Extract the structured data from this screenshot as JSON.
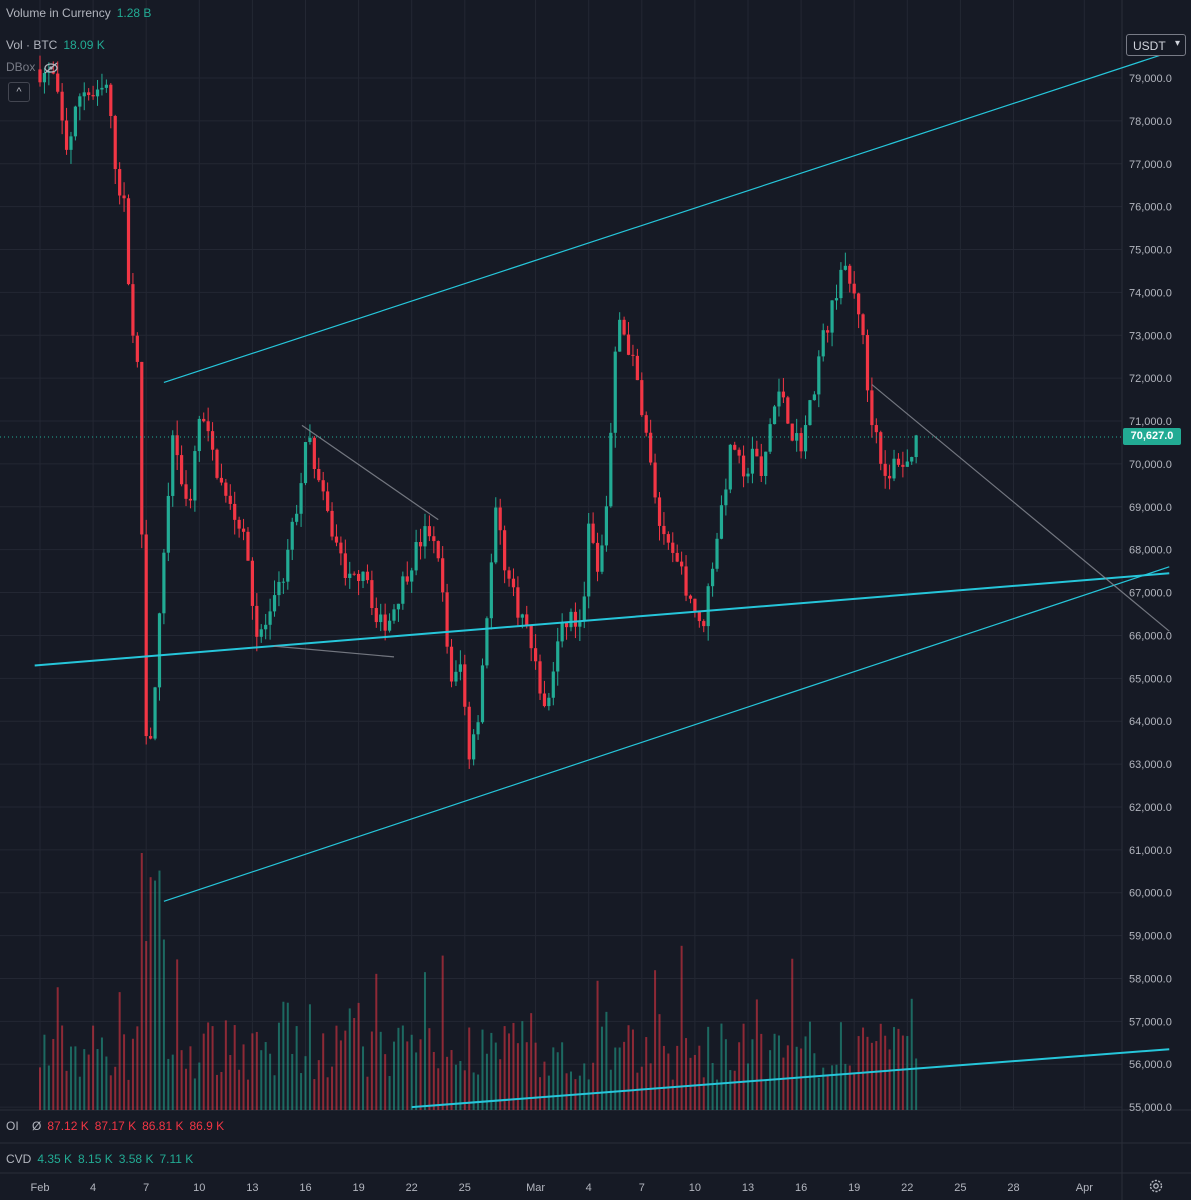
{
  "header": {
    "volume_in_currency_label": "Volume in Currency",
    "volume_in_currency_value": "1.28 B",
    "vol_label": "Vol · BTC",
    "vol_value": "18.09 K",
    "dbox_label": "DBox",
    "collapse_symbol": "^"
  },
  "currency_selector": {
    "value": "USDT"
  },
  "last_price_label": "70,627.0",
  "oi_row": {
    "label": "OI",
    "symbol": "Ø",
    "v1": "87.12 K",
    "v2": "87.17 K",
    "v3": "86.81 K",
    "v4": "86.9 K"
  },
  "cvd_row": {
    "label": "CVD",
    "v1": "4.35 K",
    "v2": "8.15 K",
    "v3": "3.58 K",
    "v4": "7.11 K"
  },
  "colors": {
    "up": "#22ab94",
    "down": "#f23645",
    "trend": "#26c6da",
    "grid": "#232733",
    "bg": "#161a25"
  },
  "chart_data": {
    "type": "candlestick",
    "y_axis": {
      "min": 54700,
      "max": 80300,
      "step": 1000,
      "tick_labels": [
        "79,000.0",
        "78,000.0",
        "77,000.0",
        "76,000.0",
        "75,000.0",
        "74,000.0",
        "73,000.0",
        "72,000.0",
        "71,000.0",
        "70,000.0",
        "69,000.0",
        "68,000.0",
        "67,000.0",
        "66,000.0",
        "65,000.0",
        "64,000.0",
        "63,000.0",
        "62,000.0",
        "61,000.0",
        "60,000.0",
        "59,000.0",
        "58,000.0",
        "57,000.0",
        "56,000.0",
        "55,000.0"
      ]
    },
    "x_axis": {
      "tick_labels": [
        "Feb",
        "4",
        "7",
        "10",
        "13",
        "16",
        "19",
        "22",
        "25",
        "Mar",
        "4",
        "7",
        "10",
        "13",
        "16",
        "19",
        "22",
        "25",
        "28",
        "Apr"
      ],
      "tick_days": [
        1,
        4,
        7,
        10,
        13,
        16,
        19,
        22,
        25,
        29,
        32,
        35,
        38,
        41,
        44,
        47,
        50,
        53,
        56,
        60
      ]
    },
    "last_price": 70627,
    "price_path": [
      [
        0.0,
        79200
      ],
      [
        1.0,
        79000
      ],
      [
        1.8,
        77300
      ],
      [
        2.6,
        78800
      ],
      [
        3.4,
        78500
      ],
      [
        4.0,
        78800
      ],
      [
        4.6,
        76700
      ],
      [
        5.0,
        76000
      ],
      [
        5.4,
        73500
      ],
      [
        5.8,
        72000
      ],
      [
        6.3,
        62900
      ],
      [
        6.8,
        65000
      ],
      [
        7.3,
        68300
      ],
      [
        7.8,
        70800
      ],
      [
        8.6,
        68800
      ],
      [
        9.3,
        71200
      ],
      [
        10.0,
        70200
      ],
      [
        10.8,
        69100
      ],
      [
        11.8,
        68500
      ],
      [
        12.5,
        66000
      ],
      [
        13.2,
        66300
      ],
      [
        14.0,
        67400
      ],
      [
        14.8,
        69100
      ],
      [
        15.4,
        70700
      ],
      [
        16.2,
        69200
      ],
      [
        17.0,
        68100
      ],
      [
        17.8,
        67200
      ],
      [
        18.6,
        67700
      ],
      [
        19.3,
        66200
      ],
      [
        20.0,
        66400
      ],
      [
        20.8,
        67300
      ],
      [
        21.6,
        68100
      ],
      [
        22.2,
        68500
      ],
      [
        22.9,
        67400
      ],
      [
        23.5,
        64800
      ],
      [
        24.0,
        65300
      ],
      [
        24.5,
        63300
      ],
      [
        25.0,
        64200
      ],
      [
        25.5,
        66500
      ],
      [
        26.0,
        68800
      ],
      [
        26.6,
        67500
      ],
      [
        27.2,
        66700
      ],
      [
        27.8,
        66100
      ],
      [
        28.4,
        65000
      ],
      [
        28.8,
        64100
      ],
      [
        29.5,
        65800
      ],
      [
        30.2,
        66500
      ],
      [
        30.8,
        66100
      ],
      [
        31.3,
        68700
      ],
      [
        31.8,
        67200
      ],
      [
        32.3,
        69300
      ],
      [
        32.9,
        73500
      ],
      [
        33.6,
        72600
      ],
      [
        34.2,
        71500
      ],
      [
        34.8,
        69800
      ],
      [
        35.4,
        68200
      ],
      [
        36.0,
        67800
      ],
      [
        36.6,
        67300
      ],
      [
        37.2,
        66700
      ],
      [
        37.6,
        66000
      ],
      [
        38.2,
        67600
      ],
      [
        38.8,
        69100
      ],
      [
        39.4,
        70600
      ],
      [
        40.0,
        69500
      ],
      [
        40.5,
        70400
      ],
      [
        41.0,
        69600
      ],
      [
        41.6,
        71200
      ],
      [
        42.2,
        71700
      ],
      [
        42.8,
        70600
      ],
      [
        43.3,
        70500
      ],
      [
        43.8,
        71400
      ],
      [
        44.4,
        72800
      ],
      [
        45.0,
        73600
      ],
      [
        45.5,
        74600
      ],
      [
        46.1,
        74100
      ],
      [
        46.6,
        73500
      ],
      [
        47.1,
        71300
      ],
      [
        47.6,
        70600
      ],
      [
        48.1,
        69300
      ],
      [
        48.6,
        70200
      ],
      [
        49.2,
        69900
      ],
      [
        49.7,
        70600
      ]
    ],
    "trendlines": [
      {
        "from": [
          7.0,
          71900
        ],
        "to": [
          63.8,
          79600
        ]
      },
      {
        "from": [
          7.0,
          59800
        ],
        "to": [
          63.8,
          67600
        ]
      },
      {
        "from": [
          -0.3,
          65300
        ],
        "to": [
          63.8,
          67450
        ]
      },
      {
        "from": [
          14.8,
          70900
        ],
        "to": [
          22.5,
          68700
        ]
      },
      {
        "from": [
          13.2,
          65750
        ],
        "to": [
          20.0,
          65500
        ]
      },
      {
        "from": [
          47.0,
          71850
        ],
        "to": [
          63.8,
          66100
        ]
      },
      {
        "from": [
          21.0,
          55000
        ],
        "to": [
          63.8,
          56350
        ]
      }
    ]
  }
}
